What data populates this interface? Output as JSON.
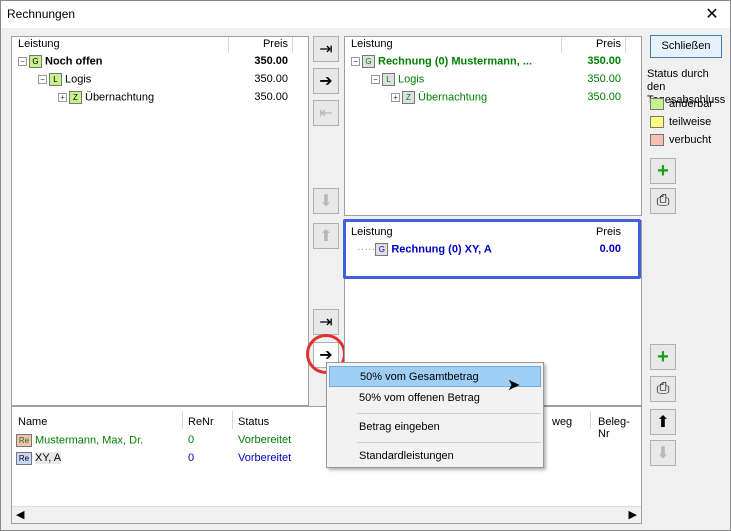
{
  "window": {
    "title": "Rechnungen",
    "close_glyph": "✕"
  },
  "left_panel": {
    "col_leistung": "Leistung",
    "col_preis": "Preis",
    "rows": [
      {
        "badge": "G",
        "label": "Noch offen",
        "price": "350.00"
      },
      {
        "badge": "L",
        "label": "Logis",
        "price": "350.00"
      },
      {
        "badge": "Z",
        "label": "Übernachtung",
        "price": "350.00"
      }
    ]
  },
  "right_top_panel": {
    "col_leistung": "Leistung",
    "col_preis": "Preis",
    "rows": [
      {
        "badge": "G",
        "label": "Rechnung (0) Mustermann, ...",
        "price": "350.00"
      },
      {
        "badge": "L",
        "label": "Logis",
        "price": "350.00"
      },
      {
        "badge": "Z",
        "label": "Übernachtung",
        "price": "350.00"
      }
    ]
  },
  "right_bottom_panel": {
    "col_leistung": "Leistung",
    "col_preis": "Preis",
    "rows": [
      {
        "badge": "G",
        "label": "Rechnung (0) XY, A",
        "price": "0.00"
      }
    ]
  },
  "bottom_panel": {
    "col_name": "Name",
    "col_renr": "ReNr",
    "col_status": "Status",
    "col_weg": "weg",
    "col_belegnr": "Beleg-Nr",
    "rows": [
      {
        "badge": "Re",
        "name": "Mustermann, Max, Dr.",
        "renr": "0",
        "status": "Vorbereitet"
      },
      {
        "badge": "Re",
        "name": "XY, A",
        "renr": "0",
        "status": "Vorbereitet"
      }
    ]
  },
  "sidebar": {
    "close_button": "Schließen",
    "status_title": "Status durch den Tagesabschluss",
    "legend": [
      {
        "label": "änderbar",
        "color": "#c8f08c"
      },
      {
        "label": "teilweise",
        "color": "#ffff80"
      },
      {
        "label": "verbucht",
        "color": "#f8c0b0"
      }
    ]
  },
  "context_menu": {
    "items": [
      "50% vom Gesamtbetrag",
      "50% vom offenen Betrag",
      "Betrag eingeben",
      "Standardleistungen"
    ],
    "highlighted_index": 0
  },
  "colors": {
    "accent_green": "#008000",
    "accent_blue": "#0000c0",
    "selection_border": "#4060e0",
    "menu_highlight": "#9fcff4",
    "annotation_circle": "#e03030"
  }
}
